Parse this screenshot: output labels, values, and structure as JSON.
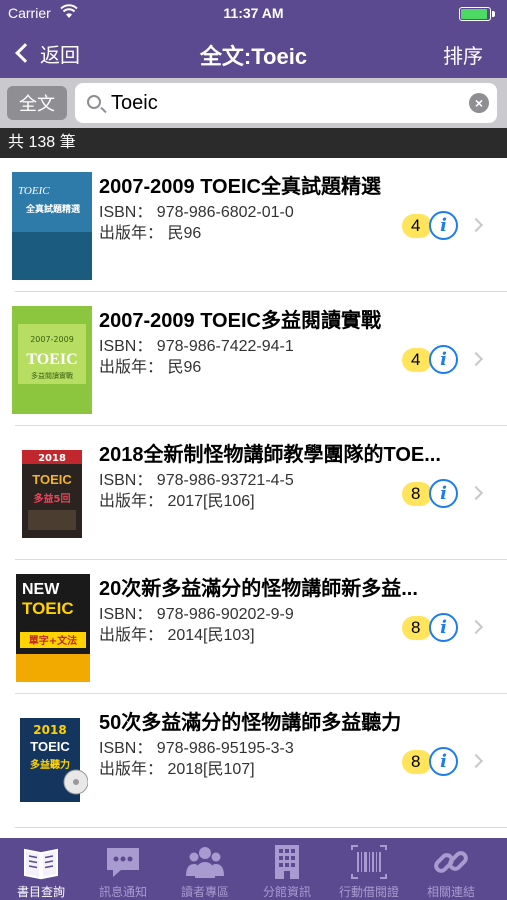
{
  "status_bar": {
    "carrier": "Carrier",
    "time": "11:37 AM"
  },
  "nav": {
    "back_label": "返回",
    "title": "全文:Toeic",
    "sort_label": "排序"
  },
  "search": {
    "scope_label": "全文",
    "query": "Toeic"
  },
  "results": {
    "count_label": "共 138 筆"
  },
  "books": [
    {
      "title": "2007-2009 TOEIC全真試題精選",
      "isbn": "ISBN：  978-986-6802-01-0",
      "year": "出版年：  民96",
      "count": "4"
    },
    {
      "title": "2007-2009 TOEIC多益閱讀實戰",
      "isbn": "ISBN：  978-986-7422-94-1",
      "year": "出版年：  民96",
      "count": "4"
    },
    {
      "title": "2018全新制怪物講師教學團隊的TOE...",
      "isbn": "ISBN：  978-986-93721-4-5",
      "year": "出版年：  2017[民106]",
      "count": "8"
    },
    {
      "title": "20次新多益滿分的怪物講師新多益...",
      "isbn": "ISBN：  978-986-90202-9-9",
      "year": "出版年：  2014[民103]",
      "count": "8"
    },
    {
      "title": "50次多益滿分的怪物講師多益聽力",
      "isbn": "ISBN：  978-986-95195-3-3",
      "year": "出版年：  2018[民107]",
      "count": "8"
    }
  ],
  "covers": [
    {
      "top_text": "TOEIC",
      "main_text": "全真試題精選"
    },
    {
      "top_text": "2007-2009",
      "main_text": "TOEIC",
      "sub_text": "多益閱讀實戰"
    },
    {
      "top_text": "2018",
      "main_text": "TOEIC",
      "sub_text": "多益5回"
    },
    {
      "top_text": "NEW",
      "main_text": "TOEIC",
      "sub_text": "單字+文法"
    },
    {
      "top_text": "2018",
      "main_text": "TOEIC",
      "sub_text": "多益聽力"
    }
  ],
  "tabs": [
    {
      "label": "書目查詢",
      "icon": "book-icon",
      "active": true
    },
    {
      "label": "訊息通知",
      "icon": "chat-bubble-icon",
      "active": false
    },
    {
      "label": "讀者專區",
      "icon": "people-icon",
      "active": false
    },
    {
      "label": "分館資訊",
      "icon": "building-icon",
      "active": false
    },
    {
      "label": "行動借閱證",
      "icon": "barcode-icon",
      "active": false
    },
    {
      "label": "相關連結",
      "icon": "link-icon",
      "active": false
    }
  ],
  "colors": {
    "header": "#5b4a8f",
    "badge": "#ffe45c",
    "info": "#1e7cf0"
  }
}
